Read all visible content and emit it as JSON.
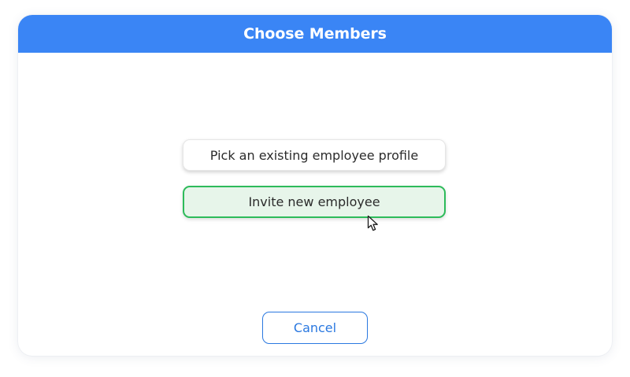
{
  "dialog": {
    "title": "Choose Members",
    "options": [
      {
        "label": "Pick an existing employee profile"
      },
      {
        "label": "Invite new employee"
      }
    ],
    "cancel_label": "Cancel"
  },
  "colors": {
    "header": "#3a85f5",
    "selected_border": "#2dbb5a",
    "selected_fill": "#e7f5ea",
    "cancel_text": "#2a78e0"
  }
}
